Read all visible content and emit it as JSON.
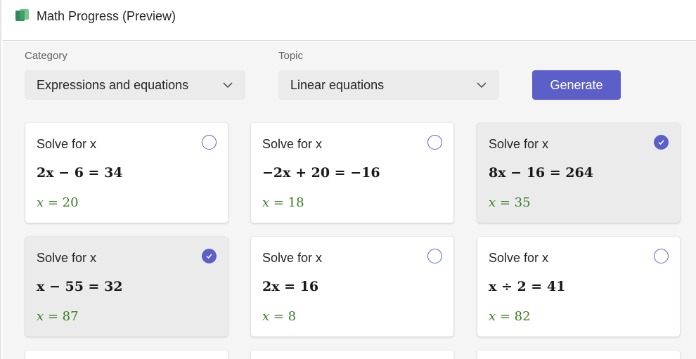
{
  "app": {
    "title": "Math Progress (Preview)",
    "icon": "math-progress-app-icon"
  },
  "filters": {
    "category_label": "Category",
    "category_value": "Expressions and equations",
    "topic_label": "Topic",
    "topic_value": "Linear equations",
    "generate_label": "Generate"
  },
  "colors": {
    "accent": "#5b5fc7",
    "answer_green": "#3a7d23",
    "selected_card_bg": "#ebebeb"
  },
  "problems": [
    {
      "prompt": "Solve for x",
      "equation": "2x − 6 = 34",
      "answer_var": "x",
      "answer_rest": " = 20",
      "selected": false
    },
    {
      "prompt": "Solve for x",
      "equation": "−2x + 20 = −16",
      "answer_var": "x",
      "answer_rest": " = 18",
      "selected": false
    },
    {
      "prompt": "Solve for x",
      "equation": "8x − 16 = 264",
      "answer_var": "x",
      "answer_rest": " = 35",
      "selected": true
    },
    {
      "prompt": "Solve for x",
      "equation": "x − 55 = 32",
      "answer_var": "x",
      "answer_rest": " = 87",
      "selected": true
    },
    {
      "prompt": "Solve for x",
      "equation": "2x = 16",
      "answer_var": "x",
      "answer_rest": " = 8",
      "selected": false
    },
    {
      "prompt": "Solve for x",
      "equation": "x ÷ 2 = 41",
      "answer_var": "x",
      "answer_rest": " = 82",
      "selected": false
    }
  ]
}
